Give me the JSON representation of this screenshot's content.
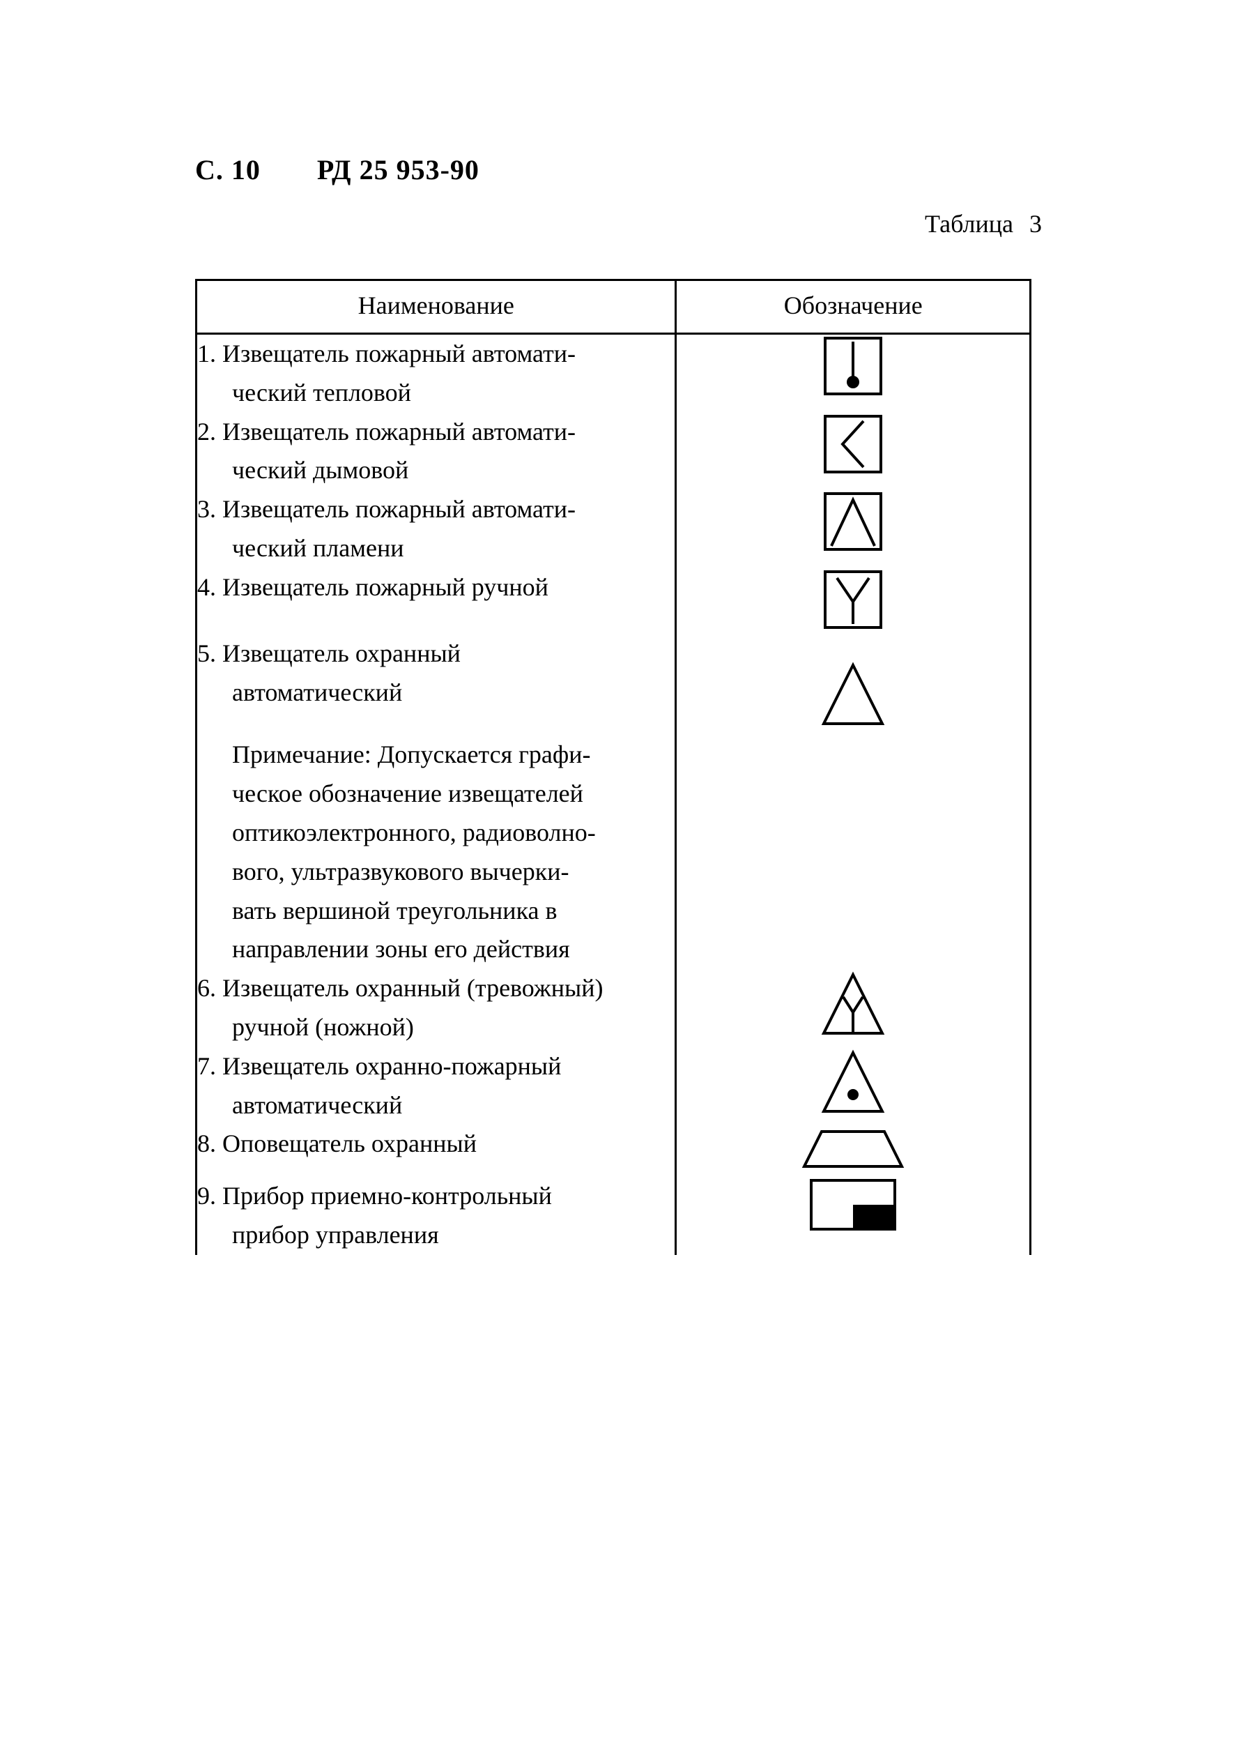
{
  "header": {
    "page_label": "С. 10",
    "doc_code": "РД 25 953-90"
  },
  "table_caption": {
    "label": "Таблица",
    "number": "3"
  },
  "columns": {
    "name": "Наименование",
    "symbol": "Обозначение"
  },
  "rows": [
    {
      "l1": "1. Извещатель пожарный автомати-",
      "l2": "ческий тепловой",
      "symbol": "heat"
    },
    {
      "l1": "2. Извещатель пожарный автомати-",
      "l2": "ческий дымовой",
      "symbol": "smoke"
    },
    {
      "l1": "3. Извещатель пожарный автомати-",
      "l2": "ческий пламени",
      "symbol": "flame"
    },
    {
      "l1": "4. Извещатель пожарный ручной",
      "l2": "",
      "symbol": "manual-fire"
    },
    {
      "l1": "5. Извещатель охранный",
      "l2": "автоматический",
      "note": "Примечание: Допускается графи-\nческое обозначение извещателей\nоптикоэлектронного, радиоволно-\nвого, ультразвукового вычерки-\nвать вершиной треугольника в\nнаправлении зоны его действия",
      "symbol": "security-auto"
    },
    {
      "l1": "6. Извещатель охранный (тревожный)",
      "l2": "ручной (ножной)",
      "symbol": "security-manual"
    },
    {
      "l1": "7. Извещатель охранно-пожарный",
      "l2": "автоматический",
      "symbol": "security-fire"
    },
    {
      "l1": "8. Оповещатель охранный",
      "l2": "",
      "symbol": "annunciator"
    },
    {
      "l1": "9. Прибор приемно-контрольный",
      "l2": "прибор управления",
      "symbol": "control-panel"
    }
  ]
}
